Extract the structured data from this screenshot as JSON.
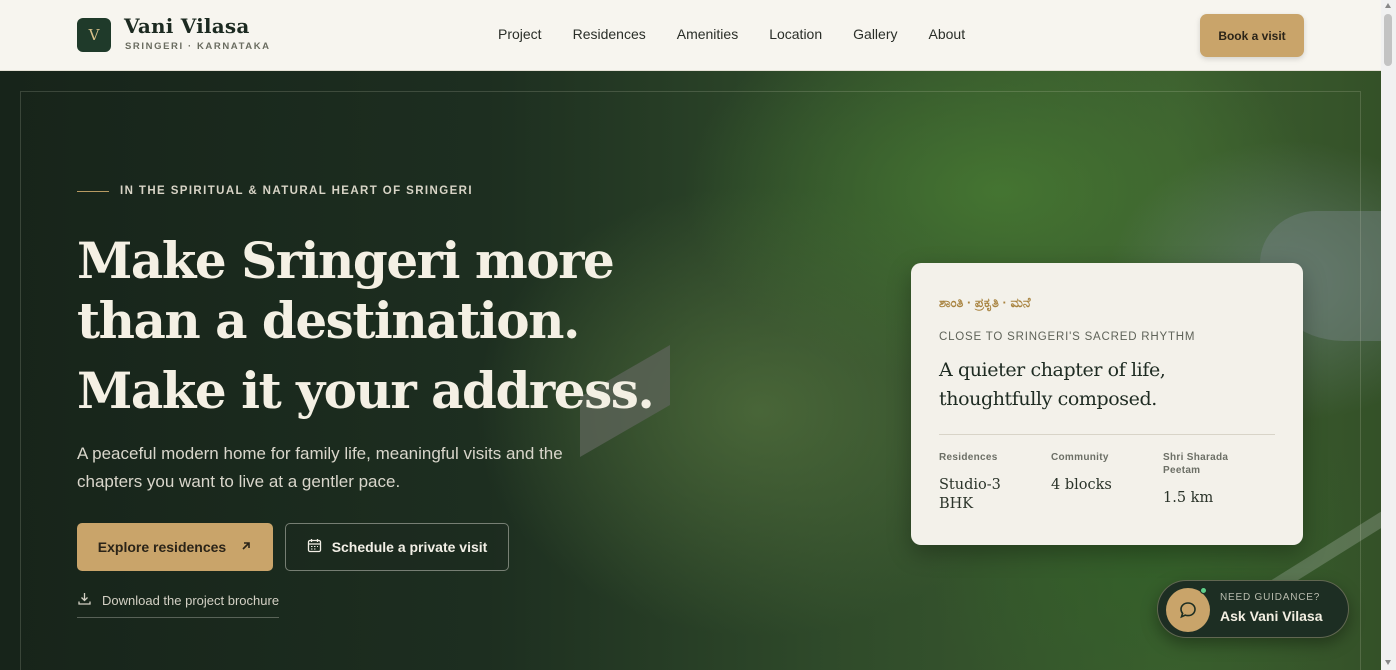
{
  "brand": {
    "logo_letter": "V",
    "name": "Vani Vilasa",
    "subtitle": "SRINGERI · KARNATAKA"
  },
  "nav": {
    "items": [
      "Project",
      "Residences",
      "Amenities",
      "Location",
      "Gallery",
      "About"
    ]
  },
  "header": {
    "cta_label": "Book a visit"
  },
  "hero": {
    "eyebrow": "IN THE SPIRITUAL & NATURAL HEART OF SRINGERI",
    "headline_line1": "Make Sringeri more",
    "headline_line2": "than a destination.",
    "headline_line3": "Make it your address.",
    "subtext": "A peaceful modern home for family life, meaningful visits and the chapters you want to live at a gentler pace.",
    "primary_cta": "Explore residences",
    "secondary_cta": "Schedule a private visit",
    "brochure_link": "Download the project brochure"
  },
  "card": {
    "kannada_tagline": "ಶಾಂತಿ · ಪ್ರಕೃತಿ · ಮನೆ",
    "eyebrow": "CLOSE TO SRINGERI'S SACRED RHYTHM",
    "title": "A quieter chapter of life, thoughtfully composed.",
    "stats": [
      {
        "label": "Residences",
        "value": "Studio-3 BHK"
      },
      {
        "label": "Community",
        "value": "4 blocks"
      },
      {
        "label": "Shri Sharada Peetam",
        "value": "1.5 km"
      }
    ]
  },
  "assistant": {
    "subtitle": "NEED GUIDANCE?",
    "title": "Ask Vani Vilasa"
  },
  "colors": {
    "accent_gold": "#c9a46a",
    "brand_green": "#1f3a2a",
    "header_bg": "#f7f5ef",
    "card_bg": "#f3f1ea",
    "status_dot": "#5fcf8a"
  },
  "icons": {
    "brochure": "download-icon",
    "visit": "calendar-icon",
    "explore": "arrow-up-right-icon",
    "assistant": "chat-bubble-icon"
  }
}
